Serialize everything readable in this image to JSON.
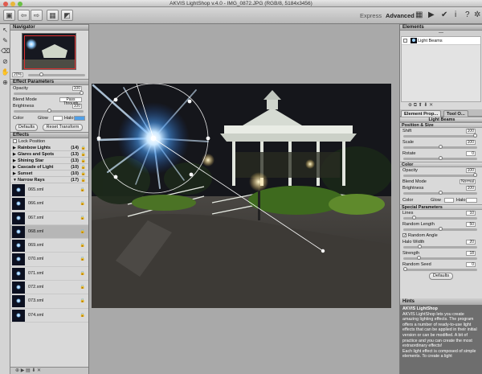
{
  "window": {
    "title": "AKVIS LightShop v.4.0 - IMG_0872.JPG (RGB/8, 5184x3456)"
  },
  "toolbar": {
    "mode_express": "Express",
    "mode_advanced": "Advanced"
  },
  "navigator": {
    "header": "Navigator",
    "zoom": "20%"
  },
  "effect_params": {
    "header": "Effect Parameters",
    "opacity_label": "Opacity",
    "opacity_value": "100",
    "blend_label": "Blend Mode",
    "blend_value": "Pass Through",
    "brightness_label": "Brightness",
    "brightness_value": "100",
    "color_label": "Color",
    "glow_label": "Glow",
    "halo_label": "Halo",
    "defaults": "Defaults",
    "reset": "Reset Transform"
  },
  "effects": {
    "header": "Effects",
    "lock_label": "Lock Position",
    "categories": [
      {
        "name": "Rainbow Lights",
        "count": "(14)"
      },
      {
        "name": "Glares and Spots",
        "count": "(13)"
      },
      {
        "name": "Shining Star",
        "count": "(13)"
      },
      {
        "name": "Cascade of Light",
        "count": "(10)"
      },
      {
        "name": "Sunset",
        "count": "(10)"
      },
      {
        "name": "Narrow Rays",
        "count": "(17)"
      }
    ],
    "items": [
      "065.xml",
      "066.xml",
      "067.xml",
      "068.xml",
      "069.xml",
      "070.xml",
      "071.xml",
      "072.xml",
      "073.xml",
      "074.xml"
    ]
  },
  "elements": {
    "header": "Elements",
    "dash": "---",
    "item": "Light Beams"
  },
  "props": {
    "tab1": "Element Prop...",
    "tab2": "Tool O...",
    "element_name": "Light Beams",
    "position_header": "Position & Size",
    "shift_label": "Shift",
    "shift_value": "100",
    "scale_label": "Scale",
    "scale_value": "100",
    "rotate_label": "Rotate",
    "rotate_value": "0",
    "color_header": "Color",
    "opacity_label": "Opacity",
    "opacity_value": "100",
    "blend_label": "Blend Mode",
    "blend_value": "Normal",
    "brightness_label": "Brightness",
    "brightness_value": "100",
    "color_label": "Color",
    "glow_label": "Glow",
    "halo_label": "Halo",
    "special_header": "Special Parameters",
    "lines_label": "Lines",
    "lines_value": "10",
    "rlength_label": "Random Length",
    "rlength_value": "50",
    "rangle_label": "Random Angle",
    "halowidth_label": "Halo Width",
    "halowidth_value": "20",
    "strength_label": "Strength",
    "strength_value": "18",
    "rseed_label": "Random Seed",
    "rseed_value": "0",
    "defaults": "Defaults"
  },
  "hints": {
    "header": "Hints",
    "title": "AKVIS LightShop",
    "body": "AKVIS LightShop lets you create amazing lighting effects. The program offers a number of ready-to-use light effects that can be applied in their initial version or can be modified. A bit of practice and you can create the most extraordinary effects!",
    "body2": "Each light effect is composed of simple elements. To create a light"
  },
  "colors": {
    "accent": "#4fa0e8",
    "panel": "#d9d9d9",
    "hints_bg": "#6e6e6e"
  }
}
